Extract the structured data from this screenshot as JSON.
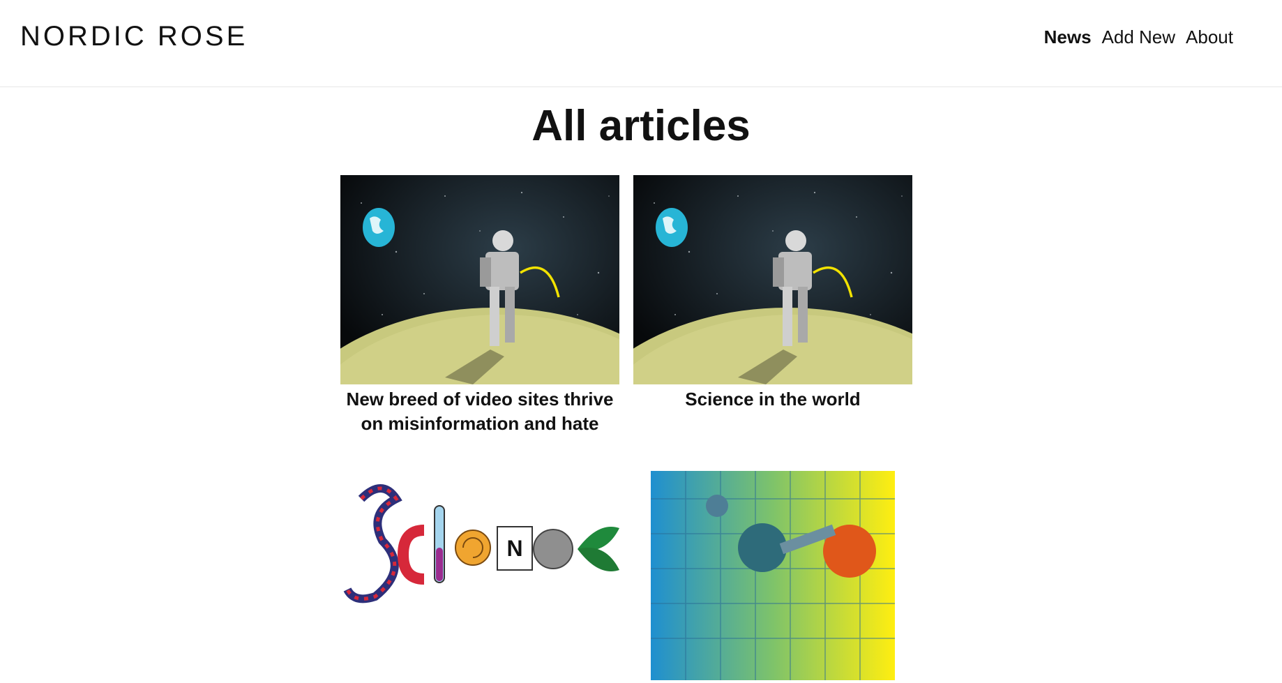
{
  "header": {
    "brand": "NORDIC ROSE",
    "nav": [
      {
        "label": "News",
        "active": true
      },
      {
        "label": "Add New",
        "active": false
      },
      {
        "label": "About",
        "active": false
      }
    ]
  },
  "main": {
    "title": "All articles",
    "articles": [
      {
        "title": "New breed of video sites thrive on misinformation and hate",
        "image": "astronaut-on-moon-illustration"
      },
      {
        "title": "Science in the world",
        "image": "astronaut-on-moon-illustration"
      },
      {
        "title": "",
        "image": "science-word-illustration"
      },
      {
        "title": "",
        "image": "periodic-table-molecule-photo"
      }
    ]
  }
}
